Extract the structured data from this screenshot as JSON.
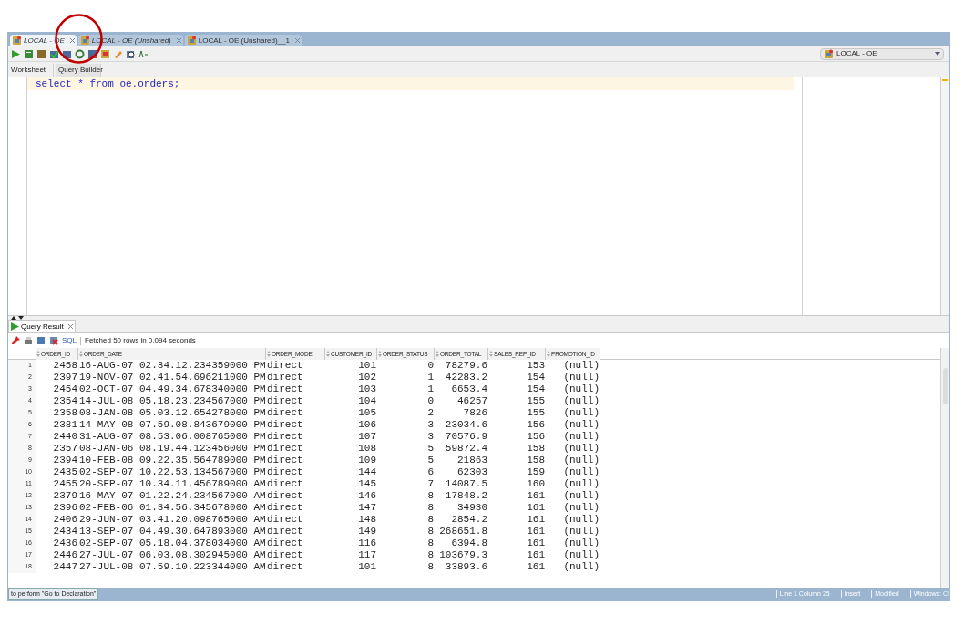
{
  "editor_tabs": [
    {
      "label": "LOCAL - OE",
      "selected": true
    },
    {
      "label": "LOCAL - OE (Unshared)",
      "selected": false
    },
    {
      "label": "LOCAL - OE (Unshared)__1",
      "selected": false
    }
  ],
  "connection": "LOCAL - OE",
  "worksheet_tabs": [
    {
      "label": "Worksheet",
      "selected": true
    },
    {
      "label": "Query Builder",
      "selected": false
    }
  ],
  "sql": "select * from oe.orders;",
  "result_tab": "Query Result",
  "result_toolbar": {
    "sql_link": "SQL",
    "message": "Fetched 50 rows in 0.094 seconds"
  },
  "table": {
    "columns": [
      "",
      "ORDER_ID",
      "ORDER_DATE",
      "ORDER_MODE",
      "CUSTOMER_ID",
      "ORDER_STATUS",
      "ORDER_TOTAL",
      "SALES_REP_ID",
      "PROMOTION_ID"
    ],
    "rows": [
      [
        "1",
        "2458",
        "16-AUG-07 02.34.12.234359000 PM",
        "direct",
        "101",
        "0",
        "78279.6",
        "153",
        "(null)"
      ],
      [
        "2",
        "2397",
        "19-NOV-07 02.41.54.696211000 PM",
        "direct",
        "102",
        "1",
        "42283.2",
        "154",
        "(null)"
      ],
      [
        "3",
        "2454",
        "02-OCT-07 04.49.34.678340000 PM",
        "direct",
        "103",
        "1",
        "6653.4",
        "154",
        "(null)"
      ],
      [
        "4",
        "2354",
        "14-JUL-08 05.18.23.234567000 PM",
        "direct",
        "104",
        "0",
        "46257",
        "155",
        "(null)"
      ],
      [
        "5",
        "2358",
        "08-JAN-08 05.03.12.654278000 PM",
        "direct",
        "105",
        "2",
        "7826",
        "155",
        "(null)"
      ],
      [
        "6",
        "2381",
        "14-MAY-08 07.59.08.843679000 PM",
        "direct",
        "106",
        "3",
        "23034.6",
        "156",
        "(null)"
      ],
      [
        "7",
        "2440",
        "31-AUG-07 08.53.06.008765000 PM",
        "direct",
        "107",
        "3",
        "70576.9",
        "156",
        "(null)"
      ],
      [
        "8",
        "2357",
        "08-JAN-06 08.19.44.123456000 PM",
        "direct",
        "108",
        "5",
        "59872.4",
        "158",
        "(null)"
      ],
      [
        "9",
        "2394",
        "10-FEB-08 09.22.35.564789000 PM",
        "direct",
        "109",
        "5",
        "21863",
        "158",
        "(null)"
      ],
      [
        "10",
        "2435",
        "02-SEP-07 10.22.53.134567000 PM",
        "direct",
        "144",
        "6",
        "62303",
        "159",
        "(null)"
      ],
      [
        "11",
        "2455",
        "20-SEP-07 10.34.11.456789000 AM",
        "direct",
        "145",
        "7",
        "14087.5",
        "160",
        "(null)"
      ],
      [
        "12",
        "2379",
        "16-MAY-07 01.22.24.234567000 AM",
        "direct",
        "146",
        "8",
        "17848.2",
        "161",
        "(null)"
      ],
      [
        "13",
        "2396",
        "02-FEB-06 01.34.56.345678000 AM",
        "direct",
        "147",
        "8",
        "34930",
        "161",
        "(null)"
      ],
      [
        "14",
        "2406",
        "29-JUN-07 03.41.20.098765000 AM",
        "direct",
        "148",
        "8",
        "2854.2",
        "161",
        "(null)"
      ],
      [
        "15",
        "2434",
        "13-SEP-07 04.49.30.647893000 AM",
        "direct",
        "149",
        "8",
        "268651.8",
        "161",
        "(null)"
      ],
      [
        "16",
        "2436",
        "02-SEP-07 05.18.04.378034000 AM",
        "direct",
        "116",
        "8",
        "6394.8",
        "161",
        "(null)"
      ],
      [
        "17",
        "2446",
        "27-JUL-07 06.03.08.302945000 AM",
        "direct",
        "117",
        "8",
        "103679.3",
        "161",
        "(null)"
      ],
      [
        "18",
        "2447",
        "27-JUL-08 07.59.10.223344000 AM",
        "direct",
        "101",
        "8",
        "33893.6",
        "161",
        "(null)"
      ]
    ]
  },
  "status_bar": [
    "to perform \"Go to Declaration\"",
    "Line 1 Column 25",
    "Insert",
    "Modified",
    "Windows: CI"
  ]
}
